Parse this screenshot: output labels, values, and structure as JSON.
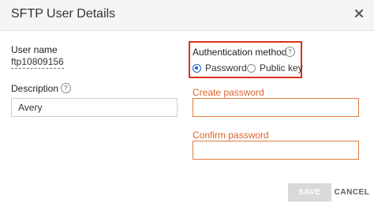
{
  "dialog": {
    "title": "SFTP User Details"
  },
  "user": {
    "label": "User name",
    "value": "ftp10809156"
  },
  "description": {
    "label": "Description",
    "value": "Avery",
    "help_icon": "question-circle-icon"
  },
  "auth": {
    "label": "Authentication method",
    "help_icon": "question-circle-icon",
    "options": [
      "Password",
      "Public key"
    ],
    "selected": "Password",
    "highlight_color": "#d9341c"
  },
  "create_password": {
    "label": "Create password",
    "value": ""
  },
  "confirm_password": {
    "label": "Confirm password",
    "value": ""
  },
  "buttons": {
    "save": "SAVE",
    "cancel": "CANCEL"
  },
  "colors": {
    "accent": "#1565c0",
    "warning": "#e0642a"
  }
}
